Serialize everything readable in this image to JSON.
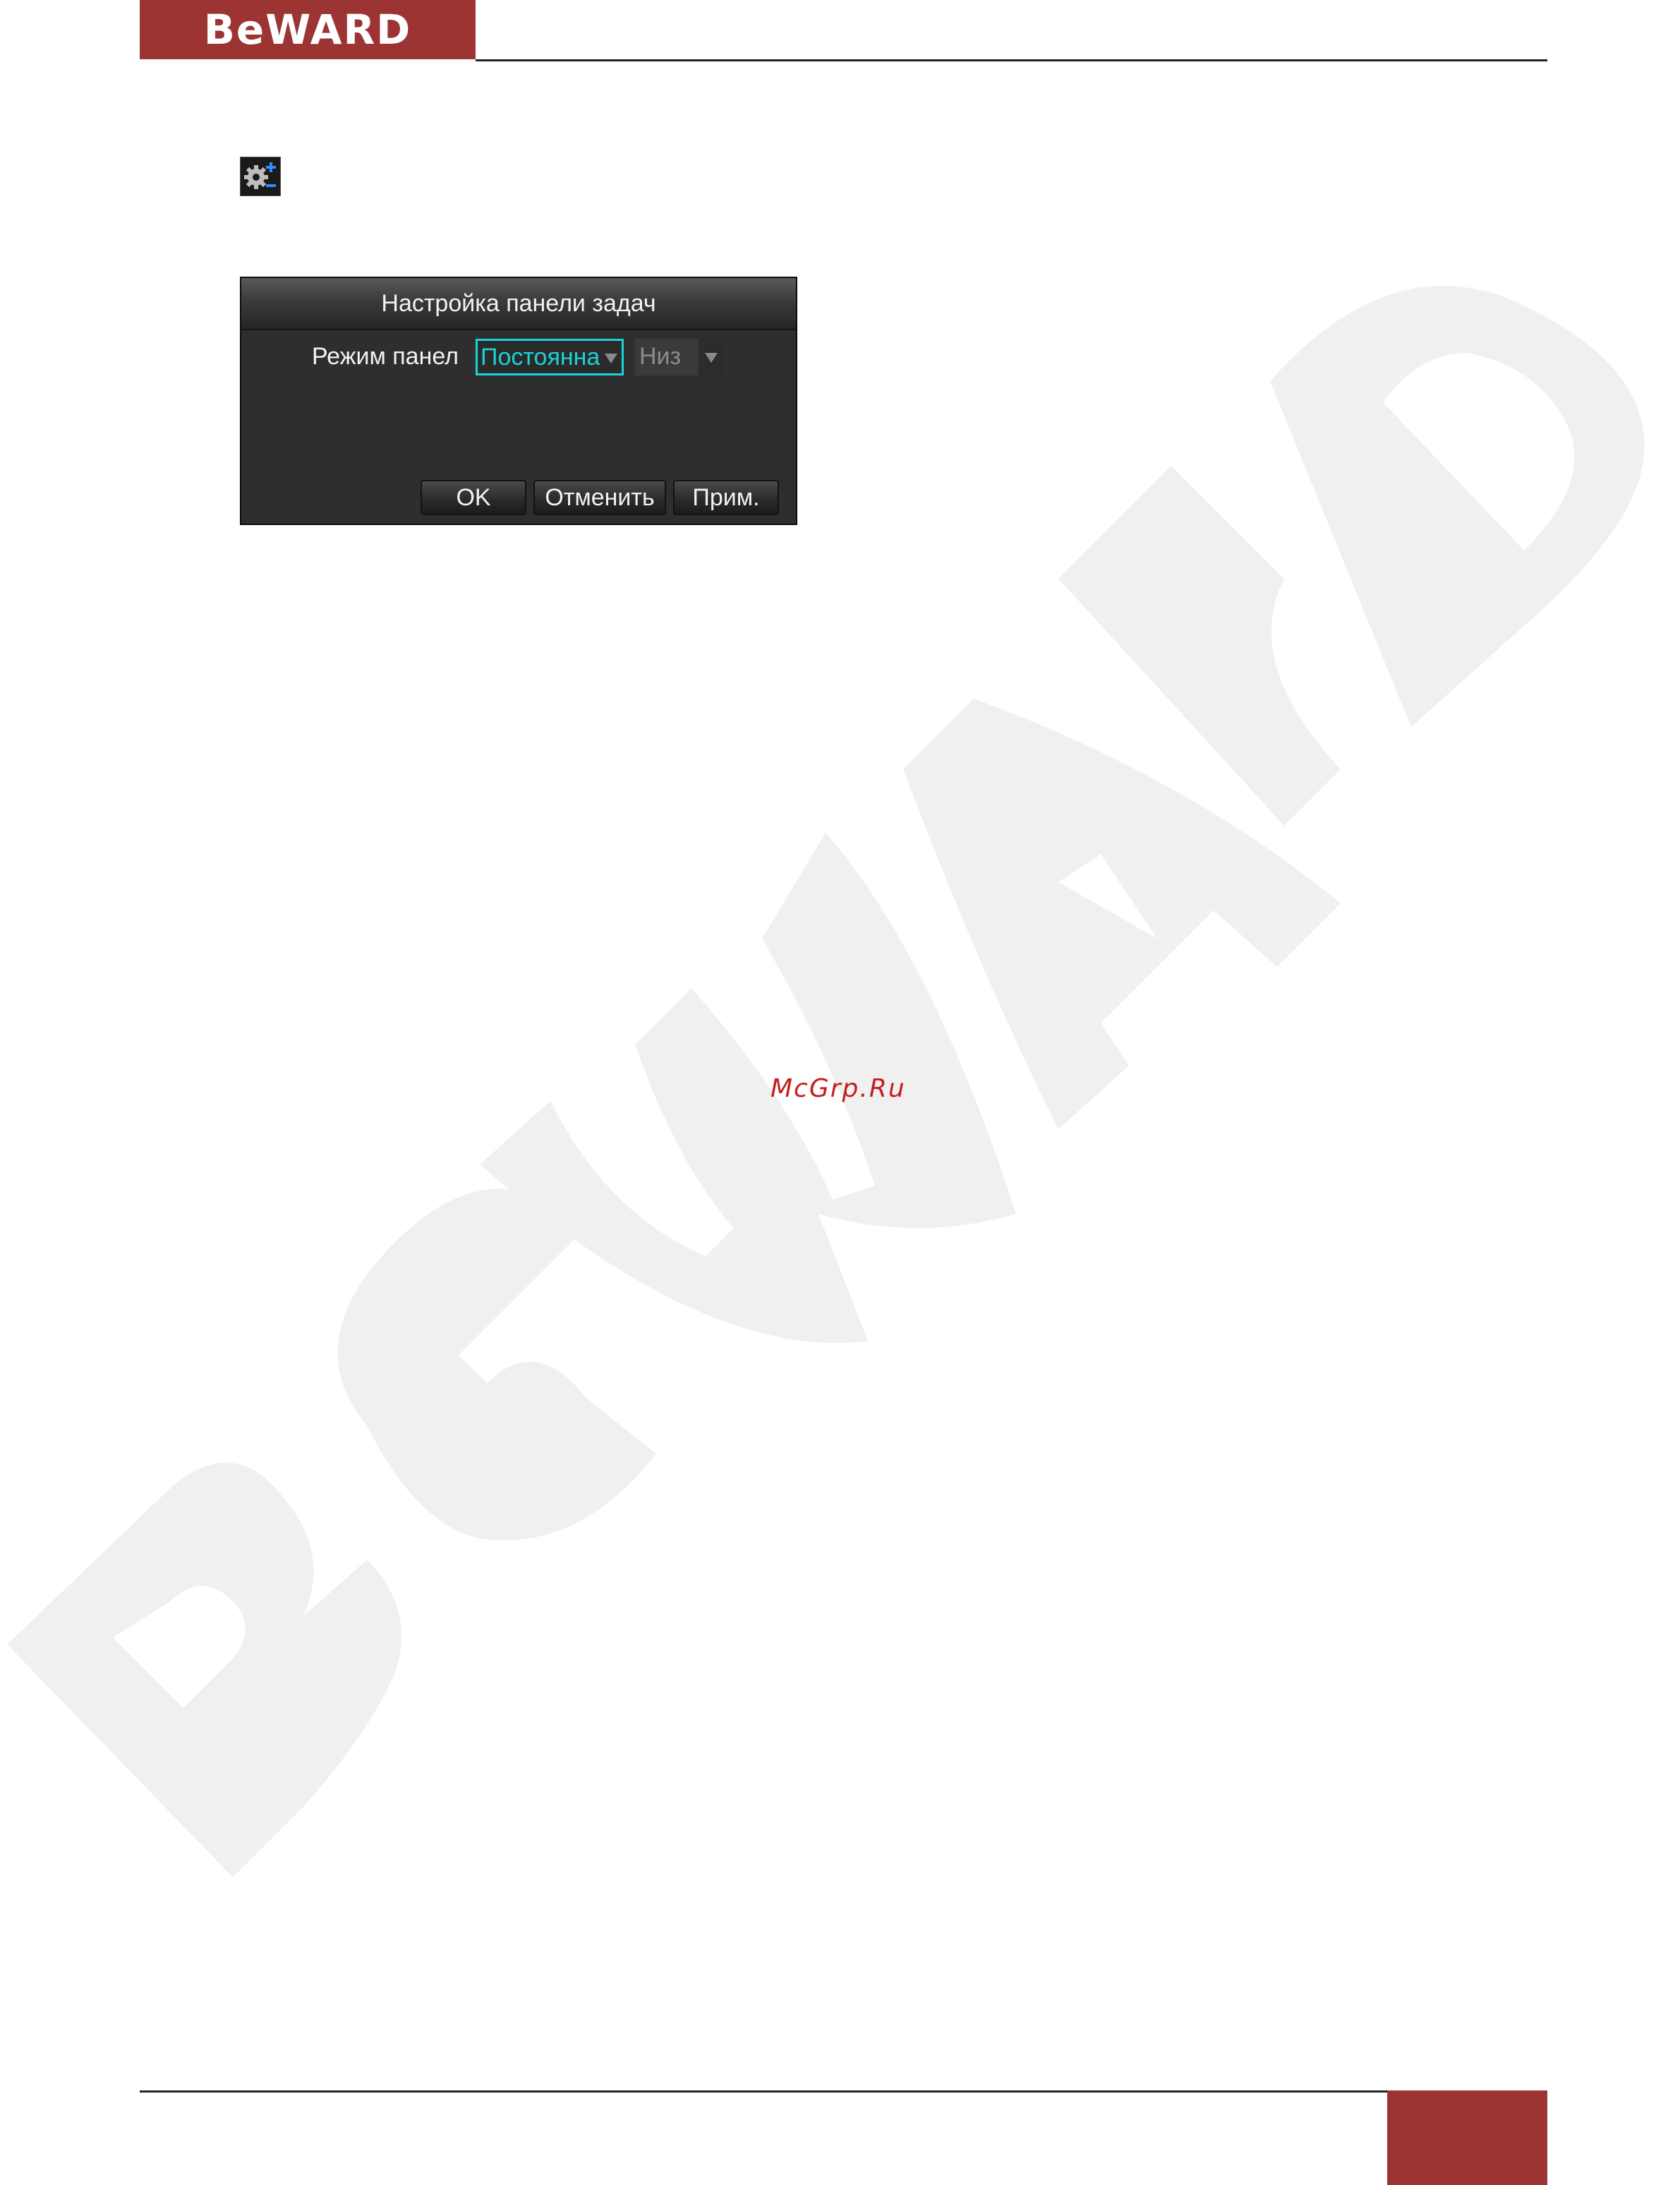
{
  "header": {
    "logo_text": "BeWARD",
    "brand_color": "#9c3434"
  },
  "watermark": {
    "text": "BeWARD",
    "color": "#f0f0f0"
  },
  "icon": {
    "name": "taskbar-settings-icon"
  },
  "dialog": {
    "title": "Настройка панели задач",
    "mode_label": "Режим панел",
    "mode_value": "Постоянна",
    "position_value": "Низ",
    "ok_label": "OK",
    "cancel_label": "Отменить",
    "apply_label": "Прим.",
    "accent_color": "#19d3d6"
  },
  "source_watermark": "McGrp.Ru"
}
